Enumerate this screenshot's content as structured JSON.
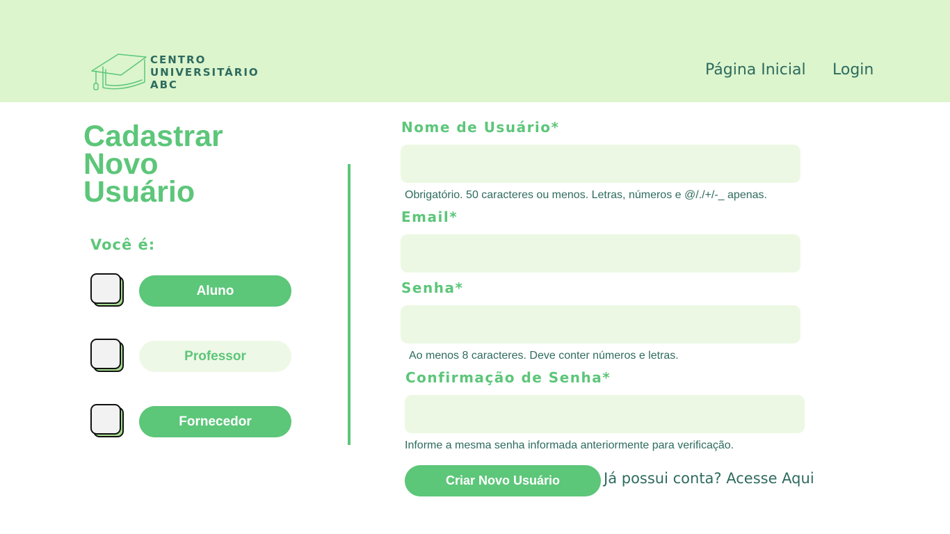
{
  "header": {
    "logo_icon": "graduation-cap-icon",
    "logo_lines": [
      "CENTRO",
      "UNIVERSITÁRIO",
      "ABC"
    ],
    "nav": {
      "home": "Página Inicial",
      "login": "Login"
    }
  },
  "title_lines": [
    "Cadastrar",
    "Novo",
    "Usuário"
  ],
  "roles": {
    "label": "Você é:",
    "items": [
      {
        "label": "Aluno",
        "state": "active"
      },
      {
        "label": "Professor",
        "state": "inactive"
      },
      {
        "label": "Fornecedor",
        "state": "active"
      }
    ]
  },
  "form": {
    "username": {
      "label": "Nome de Usuário*",
      "value": "",
      "help": "Obrigatório. 50 caracteres ou menos. Letras, números e @/./+/-_ apenas."
    },
    "email": {
      "label": "Email*",
      "value": ""
    },
    "password": {
      "label": "Senha*",
      "value": "",
      "help": "Ao menos 8 caracteres. Deve conter números e letras."
    },
    "password_confirm": {
      "label": "Confirmação de Senha*",
      "value": "",
      "help": "Informe a mesma senha informada anteriormente para verificação."
    },
    "submit_label": "Criar Novo Usuário",
    "login_link": "Já possui conta? Acesse Aqui"
  },
  "colors": {
    "header_bg": "#dcf5cd",
    "accent": "#5cc679",
    "text_dark": "#2e6b5e",
    "input_bg": "#ecf8e3"
  }
}
